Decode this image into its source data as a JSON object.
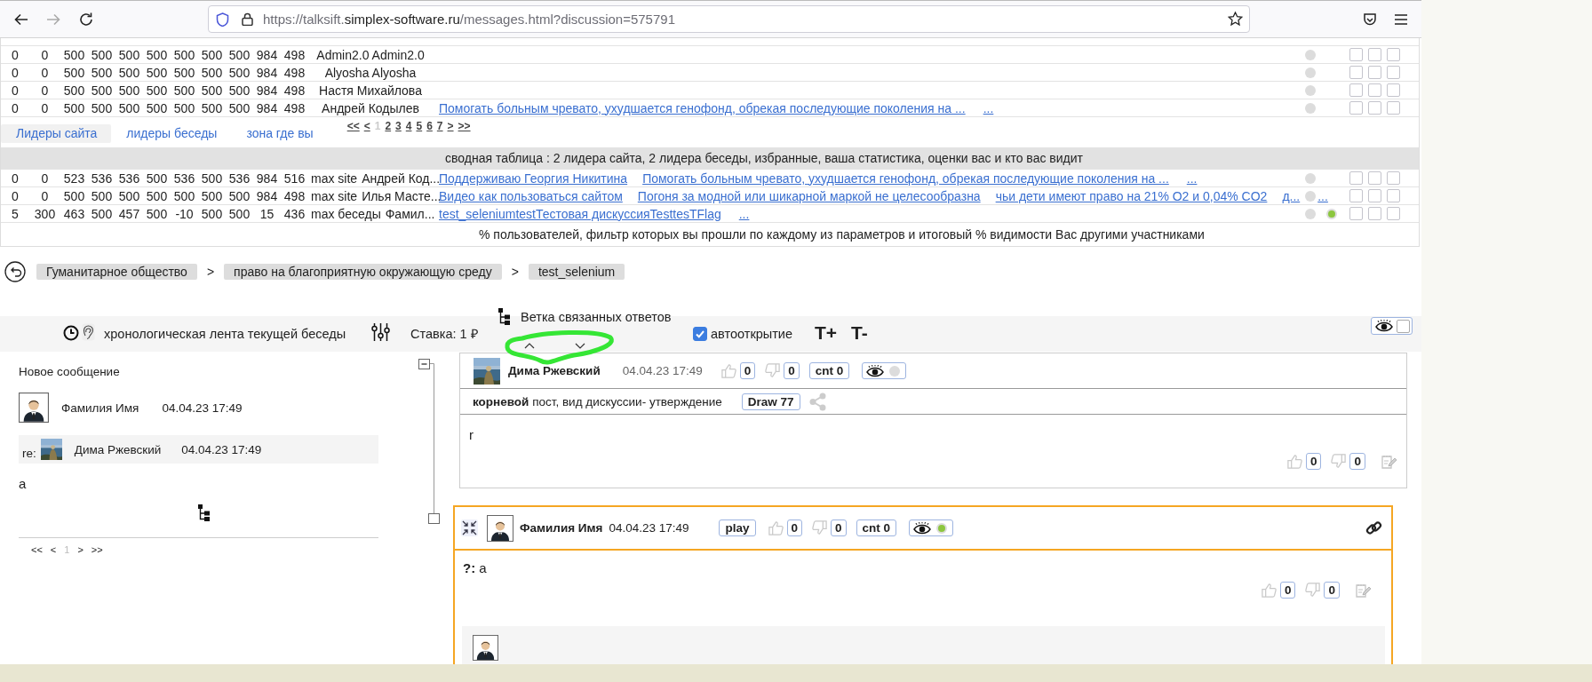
{
  "browser": {
    "url_scheme": "https://talksift.",
    "url_domain": "simplex-software.ru",
    "url_path": "/messages.html?discussion=575791"
  },
  "leaders_table": {
    "rows": [
      {
        "values": [
          "0",
          "0",
          "500",
          "500",
          "500",
          "500",
          "500",
          "500",
          "500",
          "984",
          "498"
        ],
        "name": "Admin2.0 Admin2.0",
        "online": false,
        "checks": [
          {
            "checked": false
          },
          {
            "checked": false
          },
          {
            "checked": false
          }
        ]
      },
      {
        "values": [
          "0",
          "0",
          "500",
          "500",
          "500",
          "500",
          "500",
          "500",
          "500",
          "984",
          "498"
        ],
        "name": "Alyosha Alyosha",
        "online": false,
        "checks": [
          {
            "checked": false
          },
          {
            "checked": false
          },
          {
            "checked": false
          }
        ]
      },
      {
        "values": [
          "0",
          "0",
          "500",
          "500",
          "500",
          "500",
          "500",
          "500",
          "500",
          "984",
          "498"
        ],
        "name": "Настя Михайлова",
        "online": false,
        "checks": [
          {
            "checked": false
          },
          {
            "checked": false
          },
          {
            "checked": false
          }
        ]
      },
      {
        "values": [
          "0",
          "0",
          "500",
          "500",
          "500",
          "500",
          "500",
          "500",
          "500",
          "984",
          "498"
        ],
        "name": "Андрей Кодылев",
        "links": [
          "Помогать больным чревато, ухудшается генофонд, обрекая последующие поколения на ..."
        ],
        "more": "...",
        "online": false,
        "checks": [
          {
            "checked": false
          },
          {
            "checked": false
          },
          {
            "checked": false
          }
        ]
      }
    ],
    "tabs": [
      {
        "label": "Лидеры сайта",
        "selected": true
      },
      {
        "label": "лидеры беседы",
        "selected": false
      },
      {
        "label": "зона где вы",
        "selected": false
      }
    ],
    "pager": [
      {
        "label": "<<",
        "selected": false
      },
      {
        "label": "<",
        "selected": false
      },
      {
        "label": "1",
        "selected": true
      },
      {
        "label": "2",
        "selected": false
      },
      {
        "label": "3",
        "selected": false
      },
      {
        "label": "4",
        "selected": false
      },
      {
        "label": "5",
        "selected": false
      },
      {
        "label": "6",
        "selected": false
      },
      {
        "label": "7",
        "selected": false
      },
      {
        "label": ">",
        "selected": false
      },
      {
        "label": ">>",
        "selected": false
      }
    ]
  },
  "summary_table": {
    "title": "сводная таблица : 2 лидера сайта, 2 лидера беседы, избранные, ваша статистика, оценки вас и кто вас видит",
    "rows": [
      {
        "values": [
          "0",
          "0",
          "523",
          "536",
          "536",
          "500",
          "536",
          "500",
          "536",
          "984",
          "516"
        ],
        "group": "max site",
        "name": "Андрей Код...",
        "links": [
          "Поддерживаю Георгия Никитина",
          "Помогать больным чревато, ухудшается генофонд, обрекая последующие поколения на ..."
        ],
        "more": "...",
        "online": false,
        "checks": [
          {
            "checked": false
          },
          {
            "checked": false
          },
          {
            "checked": false
          }
        ]
      },
      {
        "values": [
          "0",
          "0",
          "500",
          "500",
          "500",
          "500",
          "500",
          "500",
          "500",
          "984",
          "498"
        ],
        "group": "max site",
        "name": "Илья Масте...",
        "links": [
          "Видео как пользоваться сайтом",
          "Погоня за модной или шикарной маркой не целесообразна",
          "чьи дети имеют право на 21% O2 и 0,04% CO2",
          "д..."
        ],
        "more": "...",
        "online": false,
        "checks": [
          {
            "checked": false
          },
          {
            "checked": false
          },
          {
            "checked": false
          }
        ]
      },
      {
        "values": [
          "5",
          "300",
          "463",
          "500",
          "457",
          "500",
          "-10",
          "500",
          "500",
          "15",
          "436"
        ],
        "group": "max беседы",
        "name": "Фамил...",
        "links": [
          "test_seleniumtestТестовая дискуссияTesttesTFlag"
        ],
        "more": "...",
        "online": true,
        "checks": [
          {
            "checked": false
          },
          {
            "checked": false
          },
          {
            "checked": false
          }
        ]
      }
    ],
    "footer": "% пользователей, фильтр которых вы прошли по каждому из параметров и итоговый % видимости Вас другими участниками"
  },
  "breadcrumbs": [
    {
      "label": "Гуманитарное общество",
      "separator": ">"
    },
    {
      "label": "право на благоприятную окружающую среду",
      "separator": ">"
    },
    {
      "label": "test_selenium"
    }
  ],
  "toolbar": {
    "feed_label": "хронологическая лента текущей беседы",
    "stake": "Ставка: 1 ₽",
    "branch_label": "Ветка связанных ответов",
    "autoopen": {
      "label": "автооткрытие",
      "checked": true
    },
    "font_up": "T+",
    "font_down": "T-",
    "hide_toggle": {
      "checked": false
    }
  },
  "new_message": {
    "title": "Новое сообщение",
    "author": "Фамилия Имя",
    "avatar": {
      "kind": "person"
    },
    "date": "04.04.23 17:49",
    "reply": {
      "prefix": "re:",
      "author": "Дима Ржевский",
      "date": "04.04.23 17:49"
    },
    "text": "a",
    "pager": [
      {
        "label": "<<",
        "selected": false
      },
      {
        "label": "<",
        "selected": false
      },
      {
        "label": "1",
        "selected": true
      },
      {
        "label": ">",
        "selected": false
      },
      {
        "label": ">>",
        "selected": false
      }
    ]
  },
  "posts": [
    {
      "kind": "root",
      "author": "Дима Ржевский",
      "date": "04.04.23 17:49",
      "likes": "0",
      "dislikes": "0",
      "counter": "cnt 0",
      "viewed": false,
      "caption": "**корневой** пост, вид дискуссии- утверждение",
      "draw": "Draw 77",
      "body": "r",
      "body_likes": "0",
      "body_dislikes": "0"
    },
    {
      "kind": "reply",
      "author": "Фамилия Имя",
      "avatar": {
        "kind": "person"
      },
      "date": "04.04.23 17:49",
      "play": "play",
      "likes": "0",
      "dislikes": "0",
      "counter": "cnt 0",
      "viewed": true,
      "body": "**?:** a",
      "body_likes": "0",
      "body_dislikes": "0",
      "reply_avatar": {
        "kind": "person"
      }
    }
  ]
}
